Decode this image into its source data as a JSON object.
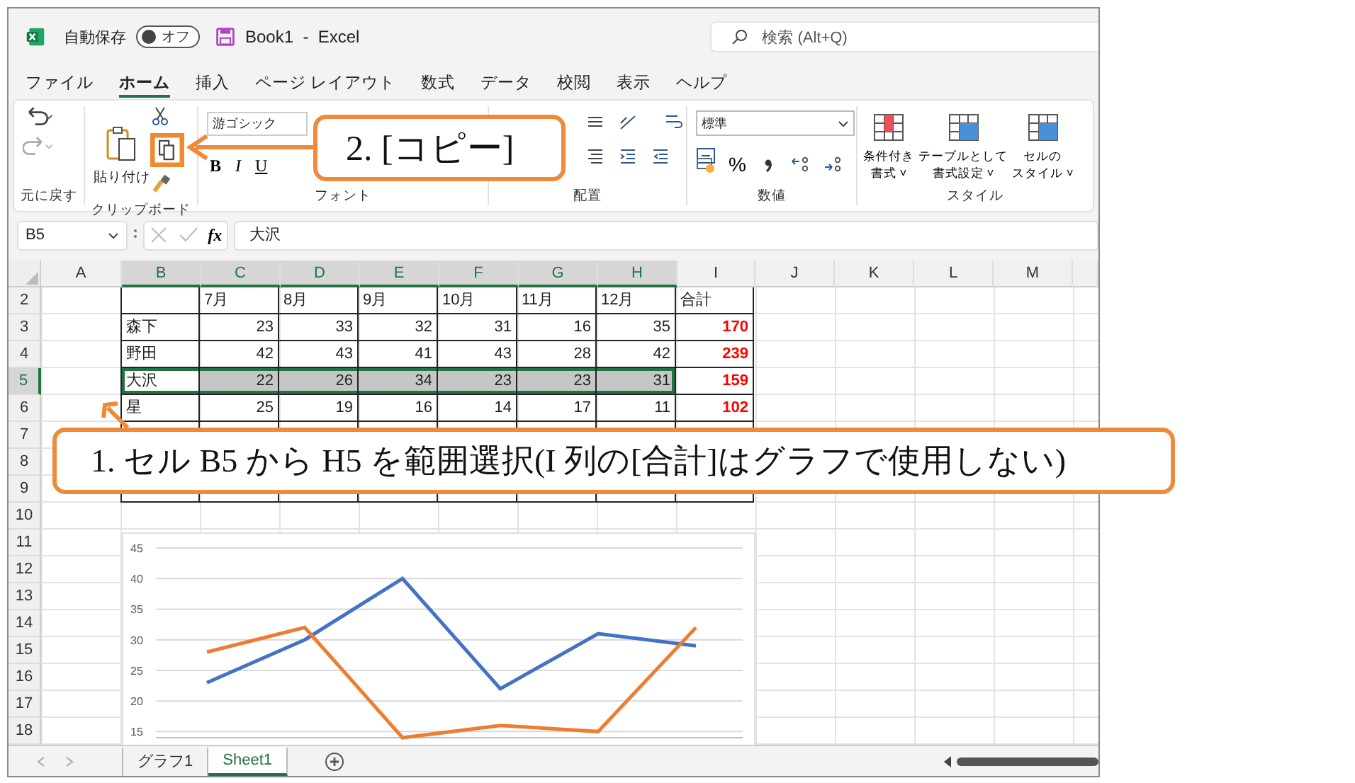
{
  "title_bar": {
    "autosave_label": "自動保存",
    "autosave_state": "オフ",
    "autosave_on": false,
    "document_title": "Book1  -  Excel",
    "search_placeholder": "検索 (Alt+Q)"
  },
  "ribbon_tabs": [
    {
      "label": "ファイル",
      "selected": false
    },
    {
      "label": "ホーム",
      "selected": true
    },
    {
      "label": "挿入",
      "selected": false
    },
    {
      "label": "ページ レイアウト",
      "selected": false
    },
    {
      "label": "数式",
      "selected": false
    },
    {
      "label": "データ",
      "selected": false
    },
    {
      "label": "校閲",
      "selected": false
    },
    {
      "label": "表示",
      "selected": false
    },
    {
      "label": "ヘルプ",
      "selected": false
    }
  ],
  "ribbon": {
    "undo_label": "元に戻す",
    "paste_label": "貼り付け",
    "clipboard_label": "クリップボード",
    "font_name": "游ゴシック",
    "font_buttons": [
      "B",
      "I",
      "U"
    ],
    "font_label": "フォント",
    "alignment_label": "配置",
    "number_format": "標準",
    "percent": "%",
    "number_label": "数値",
    "style_buttons": [
      {
        "lines": [
          "条件付き",
          "書式 ˅"
        ]
      },
      {
        "lines": [
          "テーブルとして",
          "書式設定 ˅"
        ]
      },
      {
        "lines": [
          "セルの",
          "スタイル ˅"
        ]
      }
    ],
    "styles_label": "スタイル"
  },
  "formula_bar": {
    "name_box": "B5",
    "function_label": "fx",
    "value": "大沢"
  },
  "columns": [
    {
      "label": "A",
      "selected": false
    },
    {
      "label": "B",
      "selected": true
    },
    {
      "label": "C",
      "selected": true
    },
    {
      "label": "D",
      "selected": true
    },
    {
      "label": "E",
      "selected": true
    },
    {
      "label": "F",
      "selected": true
    },
    {
      "label": "G",
      "selected": true
    },
    {
      "label": "H",
      "selected": true
    },
    {
      "label": "I",
      "selected": false
    },
    {
      "label": "J",
      "selected": false
    },
    {
      "label": "K",
      "selected": false
    },
    {
      "label": "L",
      "selected": false
    },
    {
      "label": "M",
      "selected": false
    }
  ],
  "rows": [
    {
      "header": "2",
      "kind": "heading",
      "selected": false,
      "label": "",
      "values": [
        "7月",
        "8月",
        "9月",
        "10月",
        "11月",
        "12月"
      ],
      "total": "合計"
    },
    {
      "header": "3",
      "kind": "data",
      "selected": false,
      "label": "森下",
      "values": [
        "23",
        "33",
        "32",
        "31",
        "16",
        "35"
      ],
      "total": "170"
    },
    {
      "header": "4",
      "kind": "data",
      "selected": false,
      "label": "野田",
      "values": [
        "42",
        "43",
        "41",
        "43",
        "28",
        "42"
      ],
      "total": "239"
    },
    {
      "header": "5",
      "kind": "data",
      "selected": true,
      "label": "大沢",
      "values": [
        "22",
        "26",
        "34",
        "23",
        "23",
        "31"
      ],
      "total": "159"
    },
    {
      "header": "6",
      "kind": "data",
      "selected": false,
      "label": "星",
      "values": [
        "25",
        "19",
        "16",
        "14",
        "17",
        "11"
      ],
      "total": "102"
    },
    {
      "header": "7",
      "kind": "covered",
      "selected": false
    },
    {
      "header": "8",
      "kind": "hidden",
      "selected": false
    },
    {
      "header": "9",
      "kind": "covered",
      "selected": false
    },
    {
      "header": "10",
      "kind": "blank",
      "selected": false
    },
    {
      "header": "11",
      "kind": "blank",
      "selected": false
    },
    {
      "header": "12",
      "kind": "blank",
      "selected": false
    },
    {
      "header": "13",
      "kind": "blank",
      "selected": false
    },
    {
      "header": "14",
      "kind": "blank",
      "selected": false
    },
    {
      "header": "15",
      "kind": "blank",
      "selected": false
    },
    {
      "header": "16",
      "kind": "blank",
      "selected": false
    },
    {
      "header": "17",
      "kind": "blank",
      "selected": false
    },
    {
      "header": "18",
      "kind": "blank",
      "selected": false
    }
  ],
  "chart": {
    "chart_data": {
      "type": "line",
      "grid": true,
      "ylim": [
        14,
        45
      ],
      "yticks": [
        15,
        20,
        25,
        30,
        35,
        40,
        45
      ],
      "series": [
        {
          "color": "#4472c4",
          "values": [
            23,
            30,
            40,
            22,
            31,
            29
          ]
        },
        {
          "color": "#ed7d31",
          "values": [
            28,
            32,
            14,
            16,
            15,
            32
          ]
        }
      ]
    }
  },
  "sheet_tabs": [
    {
      "label": "グラフ1",
      "selected": false
    },
    {
      "label": "Sheet1",
      "selected": true
    }
  ],
  "callouts": [
    {
      "text": "2.  [コピー]"
    },
    {
      "text": "1.  セル B5 から H5 を範囲選択(I 列の[合計]はグラフで使用しない)"
    }
  ]
}
